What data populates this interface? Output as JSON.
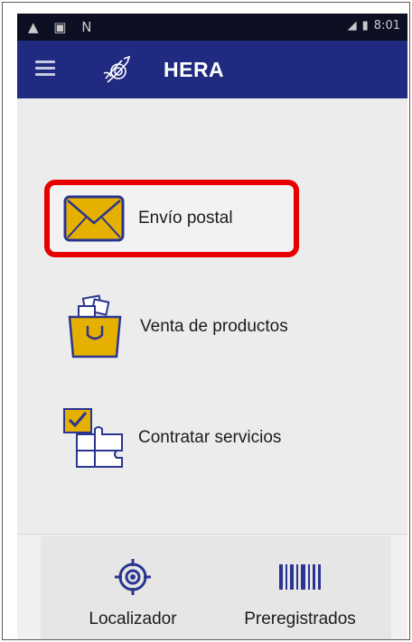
{
  "statusbar": {
    "left_icons": [
      "warning-icon",
      "image-icon",
      "n-icon"
    ],
    "left_text": "▲ ▣ N",
    "time": "8:01"
  },
  "appbar": {
    "title": "HERA",
    "color": "#1f2a80"
  },
  "menu": {
    "items": [
      {
        "label": "Envío postal",
        "icon": "envelope-icon",
        "highlighted": true
      },
      {
        "label": "Venta de productos",
        "icon": "shopping-bag-icon",
        "highlighted": false
      },
      {
        "label": "Contratar servicios",
        "icon": "puzzle-icon",
        "highlighted": false
      }
    ]
  },
  "bottom_nav": {
    "items": [
      {
        "label": "Localizador",
        "icon": "target-icon"
      },
      {
        "label": "Preregistrados",
        "icon": "barcode-icon"
      }
    ]
  },
  "colors": {
    "accent": "#e6b000",
    "highlight": "#e60000",
    "icon_outline": "#2a3590"
  }
}
